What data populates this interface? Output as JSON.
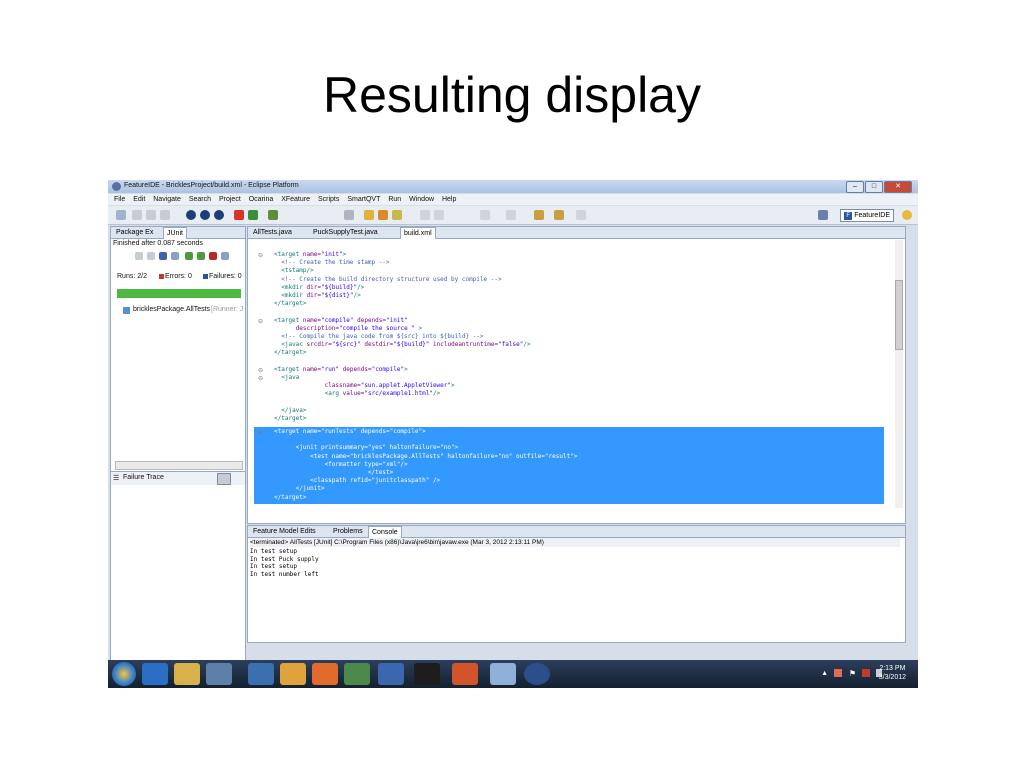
{
  "slide": {
    "title": "Resulting display"
  },
  "window": {
    "title": "FeatureIDE - BricklesProject/build.xml - Eclipse Platform"
  },
  "menu": [
    "File",
    "Edit",
    "Navigate",
    "Search",
    "Project",
    "Ocarina",
    "XFeature",
    "Scripts",
    "SmartQVT",
    "Run",
    "Window",
    "Help"
  ],
  "perspective": {
    "label": "FeatureIDE"
  },
  "left": {
    "tabs": [
      "Package Ex",
      "JUnit"
    ],
    "finished": "Finished after 0.087 seconds",
    "runs": "Runs:  2/2",
    "errors": "Errors:  0",
    "failures": "Failures:  0",
    "test_item": "bricklesPackage.AllTests",
    "test_runner": "[Runner: J",
    "failure_trace": "Failure Trace",
    "progress_status": 1.0
  },
  "editor": {
    "tabs": [
      "AllTests.java",
      "PuckSupplyTest.java",
      "build.xml"
    ]
  },
  "console": {
    "tabs": [
      "Feature Model Edits",
      "Problems",
      "Console"
    ],
    "terminated": "<terminated> AllTests [JUnit] C:\\Program Files (x86)\\Java\\jre6\\bin\\javaw.exe (Mar 3, 2012 2:13:11 PM)",
    "lines": [
      "In test setup",
      "In test Puck supply",
      "In test setup",
      "In test number left"
    ]
  },
  "taskbar": {
    "time": "2:13 PM",
    "date": "3/3/2012"
  },
  "colors": {
    "selection": "#3399ff",
    "junit_green": "#4eb842",
    "titlebar": "#a9c2e2"
  }
}
